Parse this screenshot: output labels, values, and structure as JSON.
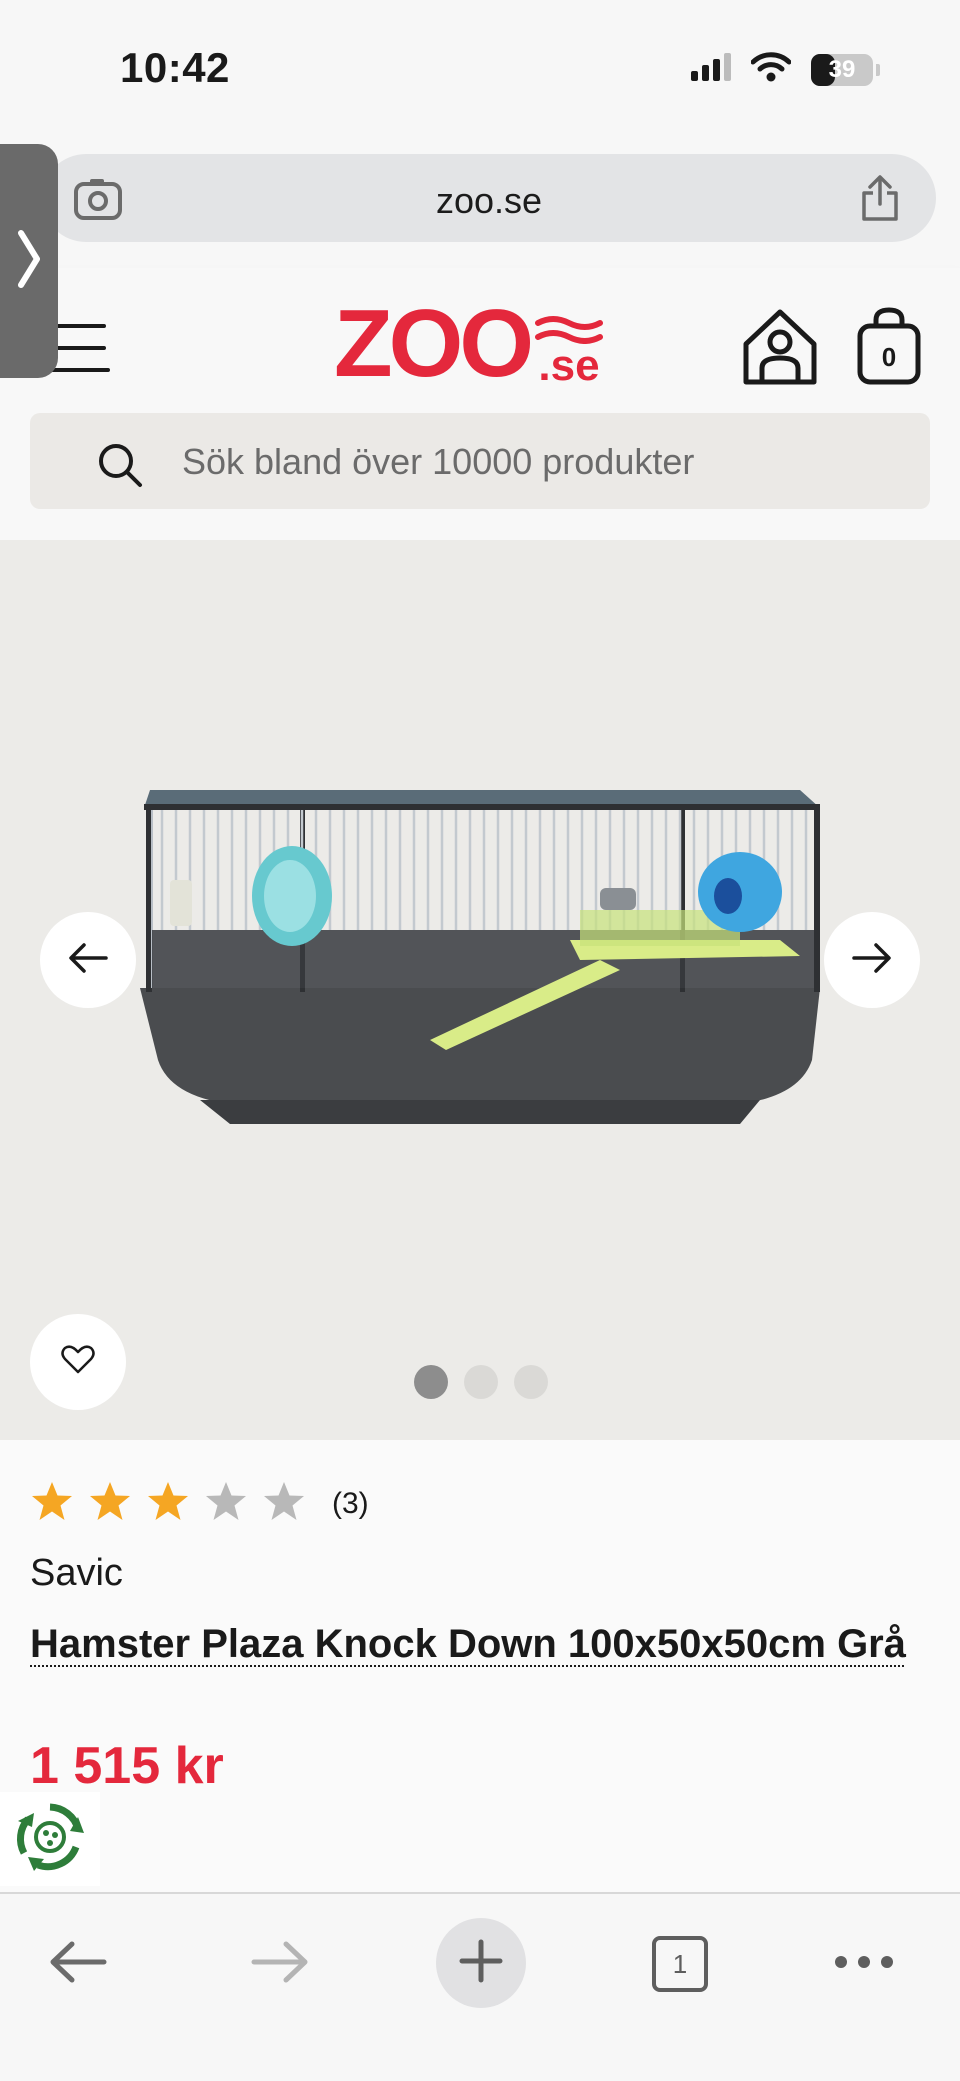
{
  "status_bar": {
    "time": "10:42",
    "battery": "39",
    "battery_level": 0.39,
    "icons": [
      "signal-icon",
      "wifi-icon",
      "battery-icon"
    ]
  },
  "browser": {
    "url": "zoo.se",
    "icons": [
      "camera-search-icon",
      "share-icon",
      "side-panel-chevron-icon"
    ]
  },
  "header": {
    "logo_main": "ZOO",
    "logo_suffix": ".se",
    "cart_count": "0",
    "search_placeholder": "Sök bland över 10000 produkter",
    "icons": [
      "menu-icon",
      "home-icon",
      "cart-icon",
      "search-icon"
    ]
  },
  "gallery": {
    "image_description_name": "hamster-cage-image",
    "dots_total": 3,
    "dots_active": 0,
    "icons": [
      "arrow-left-icon",
      "arrow-right-icon",
      "heart-icon"
    ]
  },
  "product": {
    "rating": 3,
    "rating_max": 5,
    "rating_count": "(3)",
    "brand": "Savic",
    "title": "Hamster Plaza Knock Down 100x50x50cm Grå",
    "price": "1 515 kr",
    "star_color_filled": "#f5a623",
    "star_color_empty": "#b8b8b8",
    "price_color": "#e4283c"
  },
  "toolbar": {
    "tab_count": "1",
    "icons": [
      "back-icon",
      "forward-icon",
      "new-tab-icon",
      "tabs-icon",
      "more-icon"
    ]
  }
}
